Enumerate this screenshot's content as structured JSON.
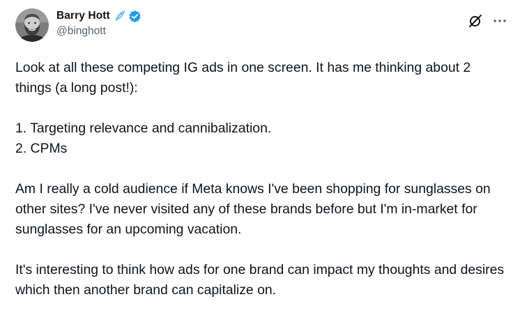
{
  "author": {
    "display_name": "Barry Hott",
    "handle": "@binghott"
  },
  "icons": {
    "avatar": "avatar-photo",
    "feather": "feather-icon",
    "verified": "verified-badge-icon",
    "grok": "grok-icon",
    "more": "more-options-icon"
  },
  "colors": {
    "text_primary": "#0f1419",
    "text_secondary": "#536471",
    "verified_blue": "#1d9bf0"
  },
  "post": {
    "paragraph_1": "Look at all these competing IG ads in one screen. It has me thinking about 2 things (a long post!):",
    "list_item_1": "1. Targeting relevance and cannibalization.",
    "list_item_2": "2. CPMs",
    "paragraph_2": "Am I really a cold audience if Meta knows I've been shopping for sunglasses on other sites? I've never visited any of these brands before but I'm in-market for sunglasses for an upcoming vacation.",
    "paragraph_3": "It's interesting to think how ads for one brand can impact my thoughts and desires which then another brand can capitalize on."
  }
}
